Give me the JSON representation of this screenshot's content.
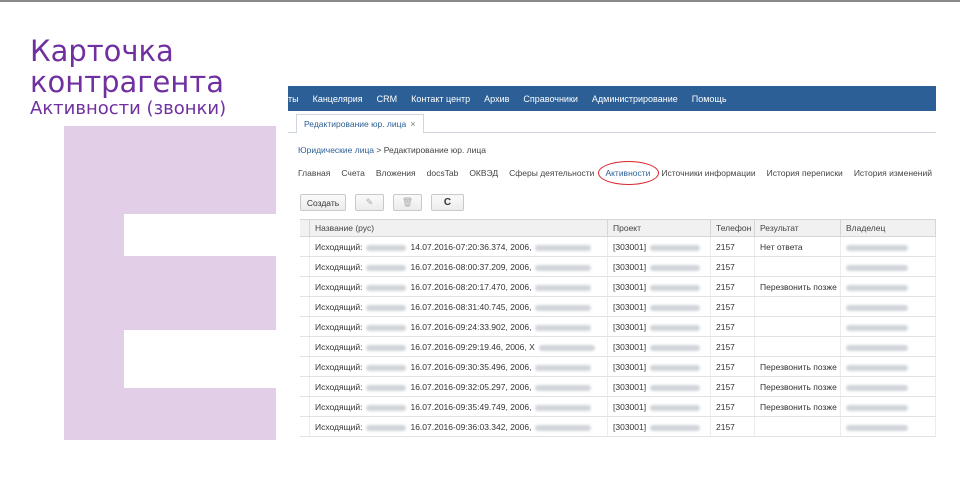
{
  "slide": {
    "title": "Карточка\nконтрагента",
    "subtitle": "Активности (звонки)"
  },
  "menubar": {
    "items": [
      "ты",
      "Канцелярия",
      "CRM",
      "Контакт центр",
      "Архив",
      "Справочники",
      "Администрирование",
      "Помощь"
    ]
  },
  "doc_tab": {
    "label": "Редактирование юр. лица",
    "close": "×"
  },
  "breadcrumb": {
    "link": "Юридические лица",
    "separator": " > ",
    "current": "Редактирование юр. лица"
  },
  "sections": [
    "Главная",
    "Счета",
    "Вложения",
    "docsTab",
    "ОКВЭД",
    "Сферы деятельности",
    "Активности",
    "Источники информации",
    "История переписки",
    "История изменений"
  ],
  "active_section": "Активности",
  "toolbar": {
    "create_label": "Создать",
    "edit_icon": "✎",
    "delete_icon": "🗑",
    "refresh_icon": "C"
  },
  "grid": {
    "columns": [
      "Название (рус)",
      "Проект",
      "Телефон",
      "Результат",
      "Владелец"
    ],
    "rows": [
      {
        "prefix": "Исходящий:",
        "datetime": "14.07.2016-07:20:36.374, 2006,",
        "project": "[303001]",
        "phone": "2157",
        "result": "Нет ответа"
      },
      {
        "prefix": "Исходящий:",
        "datetime": "16.07.2016-08:00:37.209, 2006,",
        "project": "[303001]",
        "phone": "2157",
        "result": ""
      },
      {
        "prefix": "Исходящий:",
        "datetime": "16.07.2016-08:20:17.470, 2006,",
        "project": "[303001]",
        "phone": "2157",
        "result": "Перезвонить позже"
      },
      {
        "prefix": "Исходящий:",
        "datetime": "16.07.2016-08:31:40.745, 2006,",
        "project": "[303001]",
        "phone": "2157",
        "result": ""
      },
      {
        "prefix": "Исходящий:",
        "datetime": "16.07.2016-09:24:33.902, 2006,",
        "project": "[303001]",
        "phone": "2157",
        "result": ""
      },
      {
        "prefix": "Исходящий:",
        "datetime": "16.07.2016-09:29:19.46, 2006, Х",
        "project": "[303001]",
        "phone": "2157",
        "result": ""
      },
      {
        "prefix": "Исходящий:",
        "datetime": "16.07.2016-09:30:35.496, 2006,",
        "project": "[303001]",
        "phone": "2157",
        "result": "Перезвонить позже"
      },
      {
        "prefix": "Исходящий:",
        "datetime": "16.07.2016-09:32:05.297, 2006,",
        "project": "[303001]",
        "phone": "2157",
        "result": "Перезвонить позже"
      },
      {
        "prefix": "Исходящий:",
        "datetime": "16.07.2016-09:35:49.749, 2006,",
        "project": "[303001]",
        "phone": "2157",
        "result": "Перезвонить позже"
      },
      {
        "prefix": "Исходящий:",
        "datetime": "16.07.2016-09:36:03.342, 2006,",
        "project": "[303001]",
        "phone": "2157",
        "result": ""
      }
    ]
  },
  "colors": {
    "title": "#7030a0",
    "decoration": "#e2cfe7",
    "menubar": "#2b5f96",
    "highlight_ellipse": "#d9232e"
  }
}
